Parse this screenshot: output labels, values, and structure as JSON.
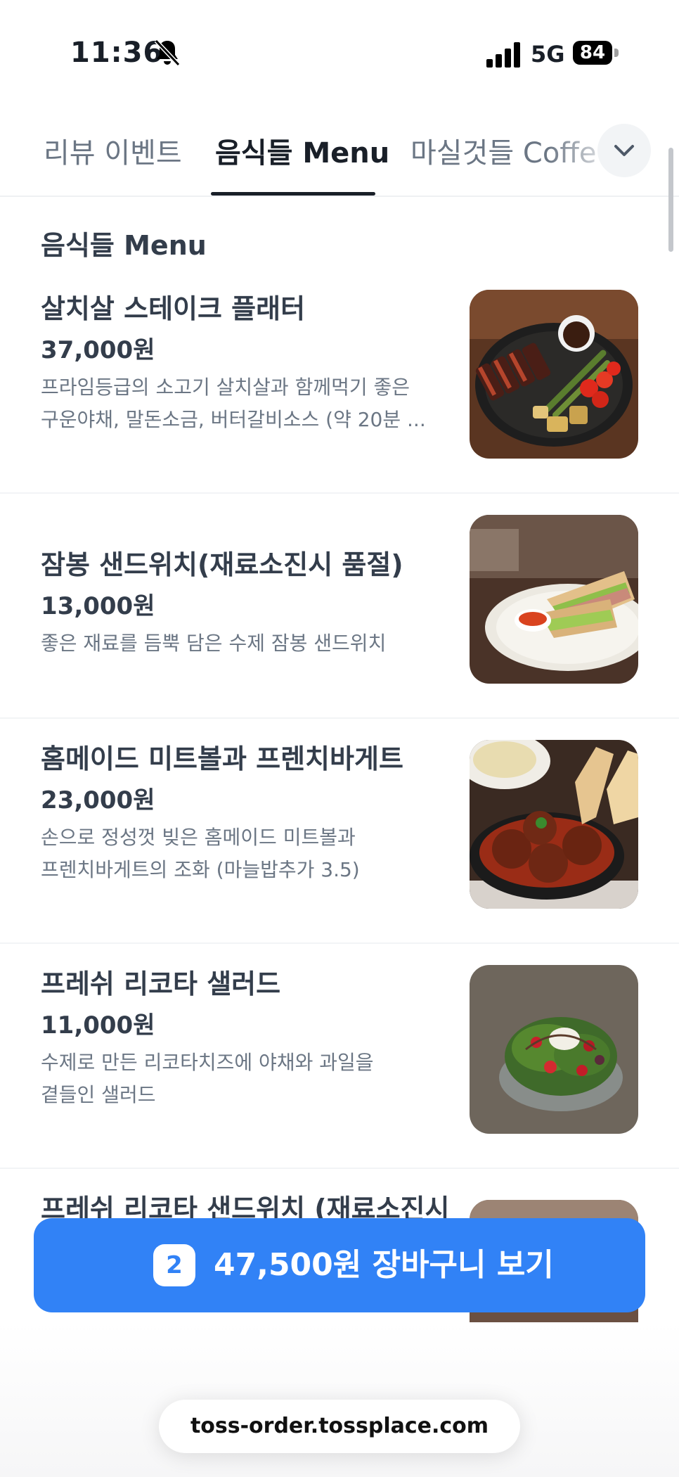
{
  "status_bar": {
    "time": "11:36",
    "network": "5G",
    "battery": "84"
  },
  "tabs": [
    {
      "label": "리뷰 이벤트",
      "active": false
    },
    {
      "label": "음식들 Menu",
      "active": true
    },
    {
      "label": "마실것들 Coffe",
      "active": false
    }
  ],
  "section": {
    "title": "음식들 Menu"
  },
  "menu_items": [
    {
      "name": "살치살 스테이크 플래터",
      "price": "37,000원",
      "desc_line1": "프라임등급의 소고기 살치살과 함께먹기 좋은",
      "desc_line2": "구운야채, 말돈소금, 버터갈비소스 (약 20분 ..."
    },
    {
      "name": "잠봉 샌드위치(재료소진시 품절)",
      "price": "13,000원",
      "desc_line1": "좋은 재료를 듬뿍 담은 수제 잠봉 샌드위치",
      "desc_line2": ""
    },
    {
      "name": "홈메이드 미트볼과 프렌치바게트",
      "price": "23,000원",
      "desc_line1": "손으로 정성껏 빚은 홈메이드 미트볼과",
      "desc_line2": "프렌치바게트의 조화 (마늘밥추가 3.5)"
    },
    {
      "name": "프레쉬 리코타 샐러드",
      "price": "11,000원",
      "desc_line1": "수제로 만든 리코타치즈에 야채와 과일을",
      "desc_line2": "곁들인 샐러드"
    },
    {
      "name": "프레쉬 리코타 샌드위치 (재료소진시",
      "price": "",
      "desc_line1": "",
      "desc_line2": ""
    }
  ],
  "cart": {
    "count": "2",
    "label": "47,500원 장바구니 보기"
  },
  "browser": {
    "url": "toss-order.tossplace.com"
  },
  "colors": {
    "accent": "#3182f6",
    "text_primary": "#333d4b",
    "text_secondary": "#6b7684"
  }
}
